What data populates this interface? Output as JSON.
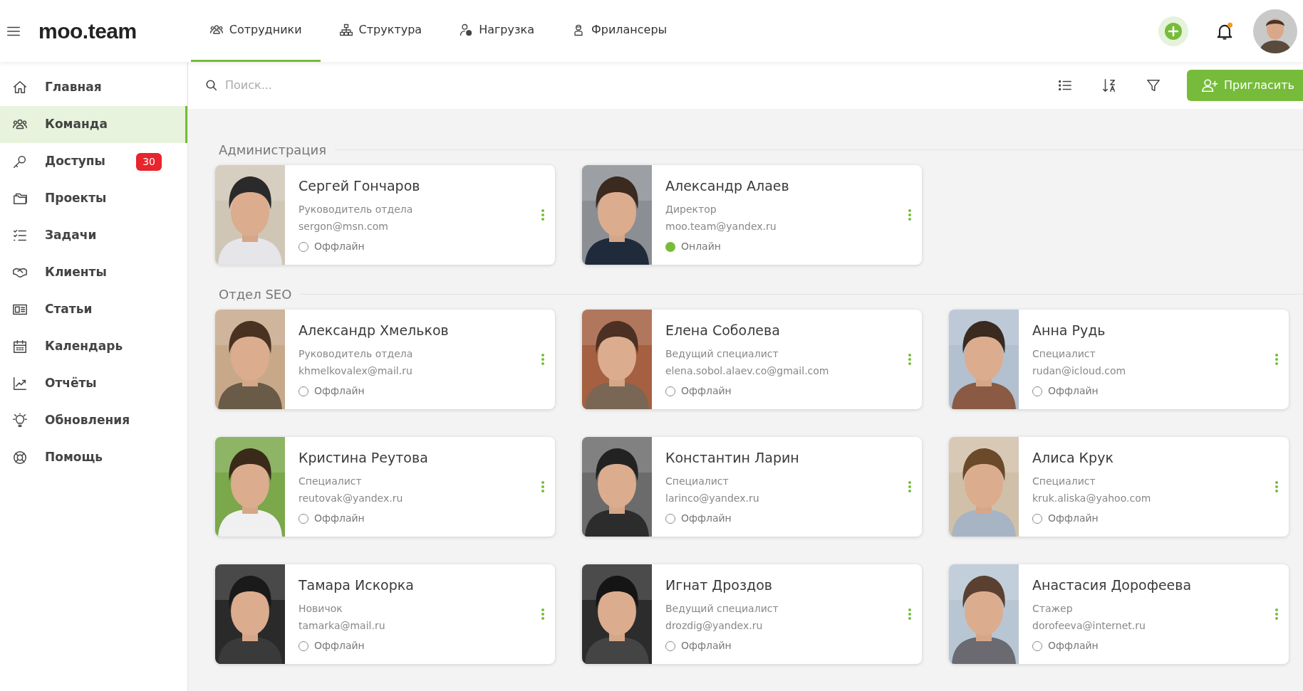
{
  "logo": "moo.team",
  "tabs": [
    {
      "label": "Сотрудники",
      "selected": true
    },
    {
      "label": "Структура",
      "selected": false
    },
    {
      "label": "Нагрузка",
      "selected": false
    },
    {
      "label": "Фрилансеры",
      "selected": false
    }
  ],
  "sidebar": {
    "items": [
      {
        "label": "Главная",
        "selected": false
      },
      {
        "label": "Команда",
        "selected": true
      },
      {
        "label": "Доступы",
        "selected": false,
        "badge": "30"
      },
      {
        "label": "Проекты",
        "selected": false
      },
      {
        "label": "Задачи",
        "selected": false
      },
      {
        "label": "Клиенты",
        "selected": false
      },
      {
        "label": "Статьи",
        "selected": false
      },
      {
        "label": "Календарь",
        "selected": false
      },
      {
        "label": "Отчёты",
        "selected": false
      },
      {
        "label": "Обновления",
        "selected": false
      },
      {
        "label": "Помощь",
        "selected": false
      }
    ]
  },
  "search": {
    "placeholder": "Поиск..."
  },
  "invite_button": "Пригласить",
  "groups": [
    {
      "title": "Администрация",
      "members": [
        {
          "name": "Сергей Гончаров",
          "role": "Руководитель отдела",
          "email": "sergon@msn.com",
          "online": false,
          "status": "Оффлайн"
        },
        {
          "name": "Александр Алаев",
          "role": "Директор",
          "email": "moo.team@yandex.ru",
          "online": true,
          "status": "Онлайн"
        }
      ]
    },
    {
      "title": "Отдел SEO",
      "members": [
        {
          "name": "Александр Хмельков",
          "role": "Руководитель отдела",
          "email": "khmelkovalex@mail.ru",
          "online": false,
          "status": "Оффлайн"
        },
        {
          "name": "Елена Соболева",
          "role": "Ведущий специалист",
          "email": "elena.sobol.alaev.co@gmail.com",
          "online": false,
          "status": "Оффлайн"
        },
        {
          "name": "Анна Рудь",
          "role": "Специалист",
          "email": "rudan@icloud.com",
          "online": false,
          "status": "Оффлайн"
        },
        {
          "name": "Кристина Реутова",
          "role": "Специалист",
          "email": "reutovak@yandex.ru",
          "online": false,
          "status": "Оффлайн"
        },
        {
          "name": "Константин Ларин",
          "role": "Специалист",
          "email": "larinco@yandex.ru",
          "online": false,
          "status": "Оффлайн"
        },
        {
          "name": "Алиса Крук",
          "role": "Специалист",
          "email": "kruk.aliska@yahoo.com",
          "online": false,
          "status": "Оффлайн"
        },
        {
          "name": "Тамара Искорка",
          "role": "Новичок",
          "email": "tamarka@mail.ru",
          "online": false,
          "status": "Оффлайн"
        },
        {
          "name": "Игнат Дроздов",
          "role": "Ведущий специалист",
          "email": "drozdig@yandex.ru",
          "online": false,
          "status": "Оффлайн"
        },
        {
          "name": "Анастасия Дорофеева",
          "role": "Стажер",
          "email": "dorofeeva@internet.ru",
          "online": false,
          "status": "Оффлайн"
        }
      ]
    }
  ]
}
